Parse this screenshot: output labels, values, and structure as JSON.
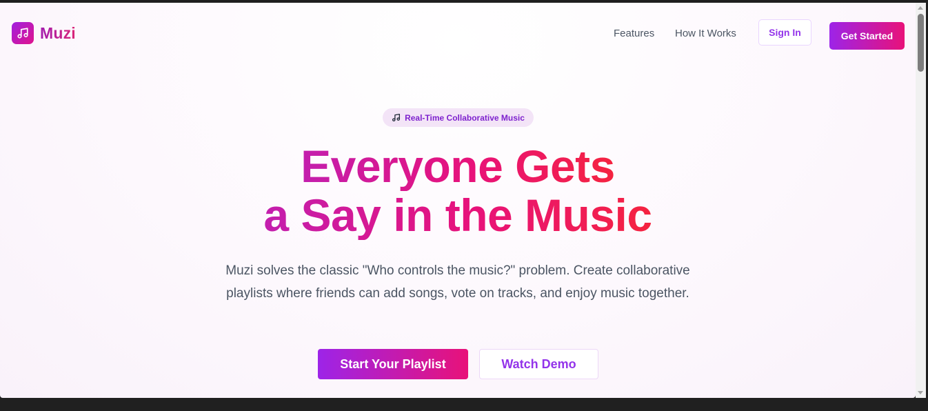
{
  "nav": {
    "brand": "Muzi",
    "brand_icon": "music-note-icon",
    "links": [
      "Features",
      "How It Works"
    ],
    "signin_label": "Sign In",
    "getstarted_label": "Get Started"
  },
  "hero": {
    "badge_icon": "music-note-icon",
    "badge_text": "Real-Time Collaborative Music",
    "title_line1": "Everyone Gets",
    "title_line2": "a Say in the Music",
    "subtitle": "Muzi solves the classic \"Who controls the music?\" problem. Create collaborative playlists where friends can add songs, vote on tracks, and enjoy music together.",
    "primary_cta": "Start Your Playlist",
    "secondary_cta": "Watch Demo"
  },
  "colors": {
    "brand_purple": "#9333ea",
    "brand_pink": "#e81279",
    "brand_red": "#f5233f",
    "body_text": "#4b5563"
  }
}
